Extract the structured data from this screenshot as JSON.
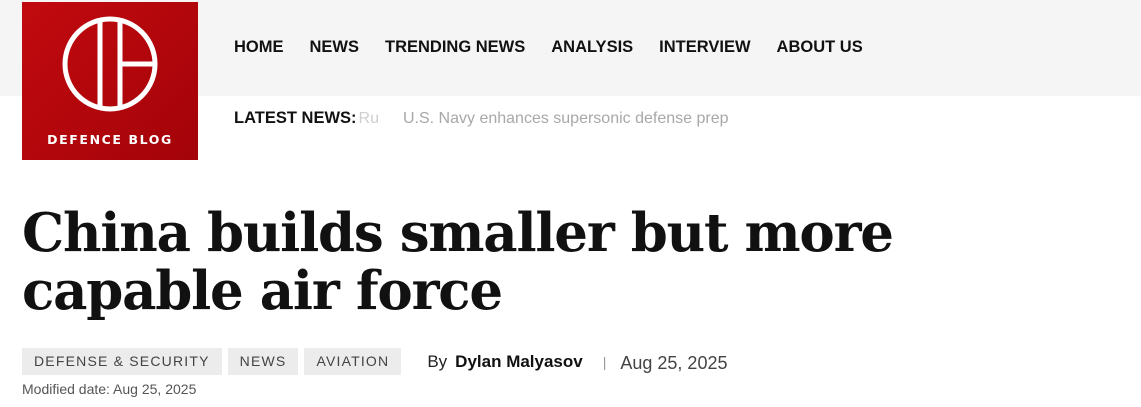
{
  "site": {
    "logo_text": "DEFENCE BLOG",
    "brand_color": "#b50610"
  },
  "nav": {
    "items": [
      {
        "label": "HOME"
      },
      {
        "label": "NEWS"
      },
      {
        "label": "TRENDING NEWS"
      },
      {
        "label": "ANALYSIS"
      },
      {
        "label": "INTERVIEW"
      },
      {
        "label": "ABOUT US"
      }
    ]
  },
  "ticker": {
    "label": "LATEST NEWS:",
    "faded_text": "Ru",
    "headline": "U.S. Navy enhances supersonic defense prep"
  },
  "article": {
    "title": "China builds smaller but more capable air force",
    "tags": [
      {
        "label": "DEFENSE & SECURITY"
      },
      {
        "label": "NEWS"
      },
      {
        "label": "AVIATION"
      }
    ],
    "by_label": "By",
    "author": "Dylan Malyasov",
    "separator": "|",
    "date": "Aug 25, 2025",
    "modified": "Modified date: Aug 25, 2025"
  }
}
